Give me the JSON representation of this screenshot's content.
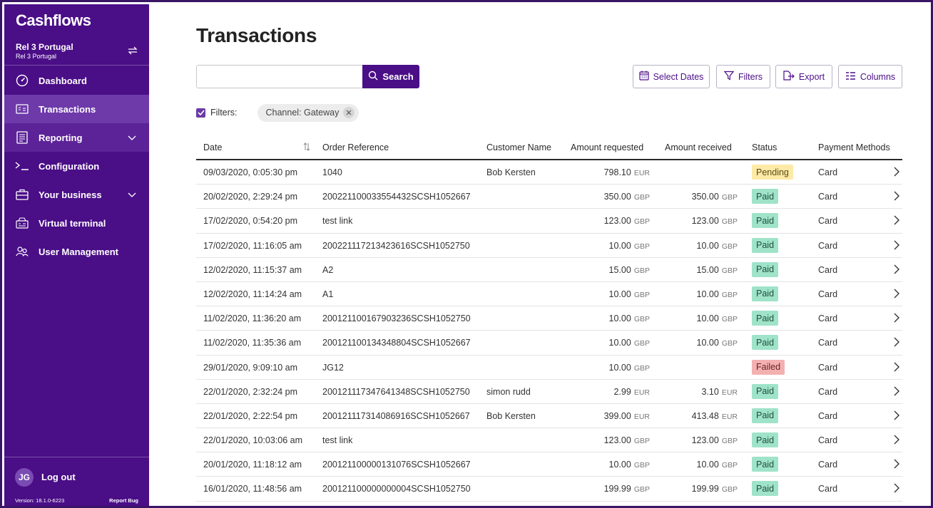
{
  "sidebar": {
    "logo": "Cashflows",
    "account_name": "Rel 3 Portugal",
    "account_sub": "Rel 3 Portugal",
    "nav": [
      {
        "label": "Dashboard",
        "icon": "dashboard-gauge-icon"
      },
      {
        "label": "Transactions",
        "icon": "transactions-card-icon",
        "active": true
      },
      {
        "label": "Reporting",
        "icon": "reporting-document-icon",
        "expandable": true
      },
      {
        "label": "Configuration",
        "icon": "terminal-prompt-icon"
      },
      {
        "label": "Your business",
        "icon": "briefcase-icon",
        "expandable": true
      },
      {
        "label": "Virtual terminal",
        "icon": "virtual-terminal-icon"
      },
      {
        "label": "User Management",
        "icon": "users-icon"
      }
    ],
    "user_initials": "JG",
    "logout_label": "Log out",
    "version": "Version: 18.1.0-6223",
    "report_bug": "Report Bug"
  },
  "page": {
    "title": "Transactions",
    "search_value": "",
    "search_label": "Search",
    "toolbar": {
      "select_dates": "Select Dates",
      "filters": "Filters",
      "export": "Export",
      "columns": "Columns"
    },
    "filters_label": "Filters:",
    "filter_chip": "Channel: Gateway"
  },
  "colors": {
    "brand": "#4a0e87",
    "paid": "#9fe3c9",
    "pending": "#fdeaa6",
    "failed": "#f3b0b0"
  },
  "table": {
    "headers": {
      "date": "Date",
      "order": "Order Reference",
      "customer": "Customer Name",
      "requested": "Amount requested",
      "received": "Amount received",
      "status": "Status",
      "methods": "Payment Methods"
    },
    "rows": [
      {
        "date": "09/03/2020, 0:05:30 pm",
        "order": "1040",
        "customer": "Bob Kersten",
        "req": "798.10",
        "req_cur": "EUR",
        "rec": "",
        "rec_cur": "",
        "status": "Pending",
        "method": "Card"
      },
      {
        "date": "20/02/2020, 2:29:24 pm",
        "order": "200221100033554432SCSH1052667",
        "customer": "",
        "req": "350.00",
        "req_cur": "GBP",
        "rec": "350.00",
        "rec_cur": "GBP",
        "status": "Paid",
        "method": "Card"
      },
      {
        "date": "17/02/2020, 0:54:20 pm",
        "order": "test link",
        "customer": "",
        "req": "123.00",
        "req_cur": "GBP",
        "rec": "123.00",
        "rec_cur": "GBP",
        "status": "Paid",
        "method": "Card"
      },
      {
        "date": "17/02/2020, 11:16:05 am",
        "order": "200221117213423616SCSH1052750",
        "customer": "",
        "req": "10.00",
        "req_cur": "GBP",
        "rec": "10.00",
        "rec_cur": "GBP",
        "status": "Paid",
        "method": "Card"
      },
      {
        "date": "12/02/2020, 11:15:37 am",
        "order": "A2",
        "customer": "",
        "req": "15.00",
        "req_cur": "GBP",
        "rec": "15.00",
        "rec_cur": "GBP",
        "status": "Paid",
        "method": "Card"
      },
      {
        "date": "12/02/2020, 11:14:24 am",
        "order": "A1",
        "customer": "",
        "req": "10.00",
        "req_cur": "GBP",
        "rec": "10.00",
        "rec_cur": "GBP",
        "status": "Paid",
        "method": "Card"
      },
      {
        "date": "11/02/2020, 11:36:20 am",
        "order": "200121100167903236SCSH1052750",
        "customer": "",
        "req": "10.00",
        "req_cur": "GBP",
        "rec": "10.00",
        "rec_cur": "GBP",
        "status": "Paid",
        "method": "Card"
      },
      {
        "date": "11/02/2020, 11:35:36 am",
        "order": "200121100134348804SCSH1052667",
        "customer": "",
        "req": "10.00",
        "req_cur": "GBP",
        "rec": "10.00",
        "rec_cur": "GBP",
        "status": "Paid",
        "method": "Card"
      },
      {
        "date": "29/01/2020, 9:09:10 am",
        "order": "JG12",
        "customer": "",
        "req": "10.00",
        "req_cur": "GBP",
        "rec": "",
        "rec_cur": "",
        "status": "Failed",
        "method": "Card"
      },
      {
        "date": "22/01/2020, 2:32:24 pm",
        "order": "200121117347641348SCSH1052750",
        "customer": "simon rudd",
        "req": "2.99",
        "req_cur": "EUR",
        "rec": "3.10",
        "rec_cur": "EUR",
        "status": "Paid",
        "method": "Card"
      },
      {
        "date": "22/01/2020, 2:22:54 pm",
        "order": "200121117314086916SCSH1052667",
        "customer": "Bob Kersten",
        "req": "399.00",
        "req_cur": "EUR",
        "rec": "413.48",
        "rec_cur": "EUR",
        "status": "Paid",
        "method": "Card"
      },
      {
        "date": "22/01/2020, 10:03:06 am",
        "order": "test link",
        "customer": "",
        "req": "123.00",
        "req_cur": "GBP",
        "rec": "123.00",
        "rec_cur": "GBP",
        "status": "Paid",
        "method": "Card"
      },
      {
        "date": "20/01/2020, 11:18:12 am",
        "order": "200121100000131076SCSH1052667",
        "customer": "",
        "req": "10.00",
        "req_cur": "GBP",
        "rec": "10.00",
        "rec_cur": "GBP",
        "status": "Paid",
        "method": "Card"
      },
      {
        "date": "16/01/2020, 11:48:56 am",
        "order": "200121100000000004SCSH1052750",
        "customer": "",
        "req": "199.99",
        "req_cur": "GBP",
        "rec": "199.99",
        "rec_cur": "GBP",
        "status": "Paid",
        "method": "Card"
      }
    ]
  }
}
